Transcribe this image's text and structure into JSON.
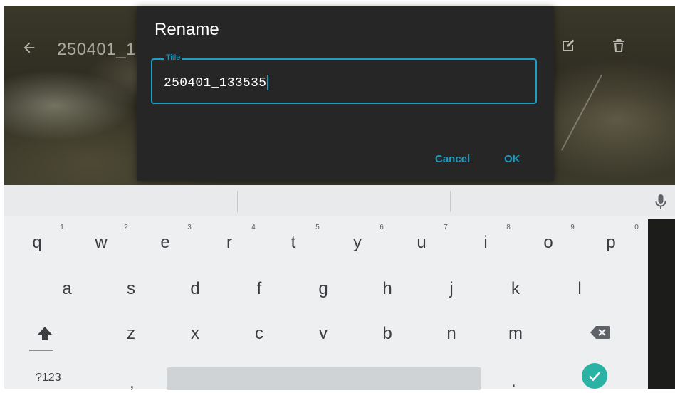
{
  "topbar": {
    "title": "250401_1",
    "back_icon": "arrow-back-icon",
    "edit_icon": "edit-icon",
    "delete_icon": "trash-icon"
  },
  "dialog": {
    "title": "Rename",
    "field_label": "Title",
    "field_value": "250401_133535",
    "cancel_label": "Cancel",
    "ok_label": "OK",
    "accent_color": "#18a0c6"
  },
  "keyboard": {
    "row1": [
      {
        "key": "q",
        "hint": "1"
      },
      {
        "key": "w",
        "hint": "2"
      },
      {
        "key": "e",
        "hint": "3"
      },
      {
        "key": "r",
        "hint": "4"
      },
      {
        "key": "t",
        "hint": "5"
      },
      {
        "key": "y",
        "hint": "6"
      },
      {
        "key": "u",
        "hint": "7"
      },
      {
        "key": "i",
        "hint": "8"
      },
      {
        "key": "o",
        "hint": "9"
      },
      {
        "key": "p",
        "hint": "0"
      }
    ],
    "row2": [
      "a",
      "s",
      "d",
      "f",
      "g",
      "h",
      "j",
      "k",
      "l"
    ],
    "row3": [
      "z",
      "x",
      "c",
      "v",
      "b",
      "n",
      "m"
    ],
    "symbols_label": "?123",
    "comma_label": ",",
    "period_label": ".",
    "mic_icon": "mic-icon",
    "shift_icon": "shift-icon",
    "backspace_icon": "backspace-icon",
    "enter_icon": "checkmark-icon",
    "enter_color": "#2ab3a5"
  }
}
